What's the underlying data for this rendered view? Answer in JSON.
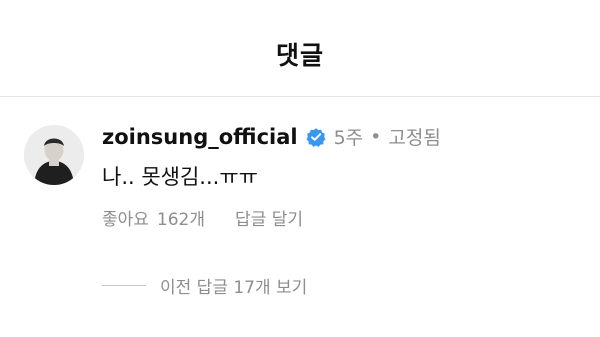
{
  "header": {
    "title": "댓글"
  },
  "comment": {
    "username": "zoinsung_official",
    "verified_icon": "verified-badge-icon",
    "time": "5주",
    "separator": "•",
    "pinned": "고정됨",
    "text": "나.. 못생김...ㅠㅠ",
    "likes_label": "좋아요",
    "likes_count": "162개",
    "reply_label": "답글 달기",
    "view_replies_label": "이전 답글 17개 보기"
  },
  "colors": {
    "text": "#111111",
    "muted": "#8e8e8e",
    "verified": "#3897f0",
    "divider": "#e6e6e6"
  }
}
